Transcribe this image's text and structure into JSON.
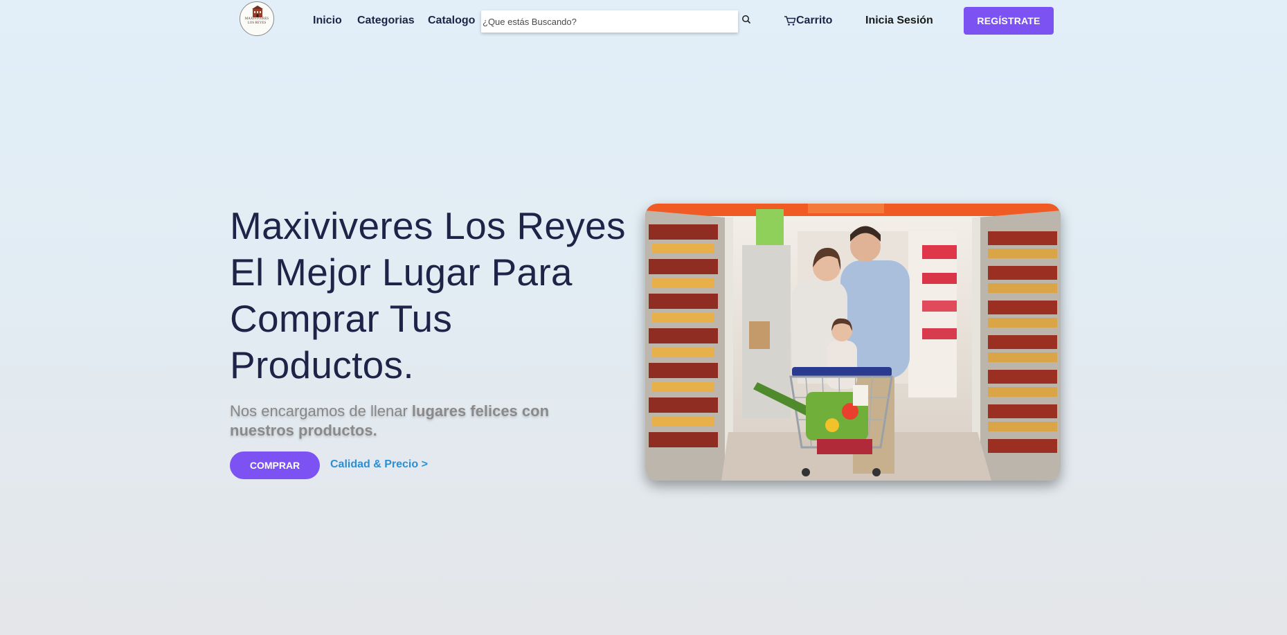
{
  "header": {
    "logo": {
      "line1": "MAXIVIVERES",
      "line2": "LOS REYES"
    },
    "nav": {
      "home": "Inicio",
      "categories": "Categorias",
      "catalog": "Catalogo"
    },
    "search": {
      "placeholder": "¿Que estás Buscando?",
      "icon": "search-icon"
    },
    "cart": {
      "label": "Carrito",
      "icon": "cart-icon"
    },
    "login": "Inicia Sesión",
    "register": "REGÍSTRATE"
  },
  "hero": {
    "title_lines": [
      "Maxiviveres Los Reyes",
      "El Mejor Lugar Para",
      "Comprar Tus",
      "Productos."
    ],
    "subtitle_plain": "Nos encargamos de llenar ",
    "subtitle_bold": "lugares felices con nuestros productos.",
    "buy_button": "COMPRAR",
    "quality_link": "Calidad & Precio >",
    "image_alt": "family-with-shopping-cart-in-supermarket-photo"
  },
  "colors": {
    "accent": "#7c52f3",
    "link": "#2a8fd6",
    "heading": "#1e2447",
    "muted": "#878787"
  }
}
